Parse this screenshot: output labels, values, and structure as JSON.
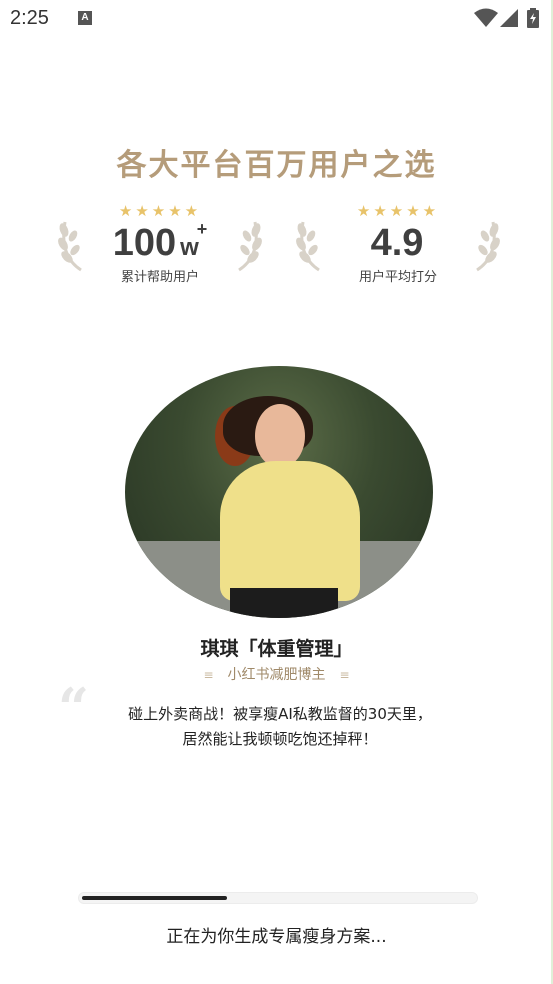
{
  "status_bar": {
    "time": "2:25",
    "notification_badge": "A"
  },
  "headline": "各大平台百万用户之选",
  "stats": [
    {
      "stars": "★★★★★",
      "value": "100",
      "unit": "w",
      "sup": "+",
      "label": "累计帮助用户"
    },
    {
      "stars": "★★★★★",
      "value": "4.9",
      "unit": "",
      "sup": "",
      "label": "用户平均打分"
    }
  ],
  "testimonial": {
    "name": "琪琪「体重管理」",
    "role": "小红书减肥博主",
    "quote_line1": "碰上外卖商战！被享瘦AI私教监督的30天里，",
    "quote_line2": "居然能让我顿顿吃饱还掉秤！"
  },
  "loading": {
    "progress": 0.37,
    "text": "正在为你生成专属瘦身方案..."
  },
  "colors": {
    "accent_gold": "#b59c7a",
    "star": "#e8c36a",
    "text": "#222222"
  }
}
